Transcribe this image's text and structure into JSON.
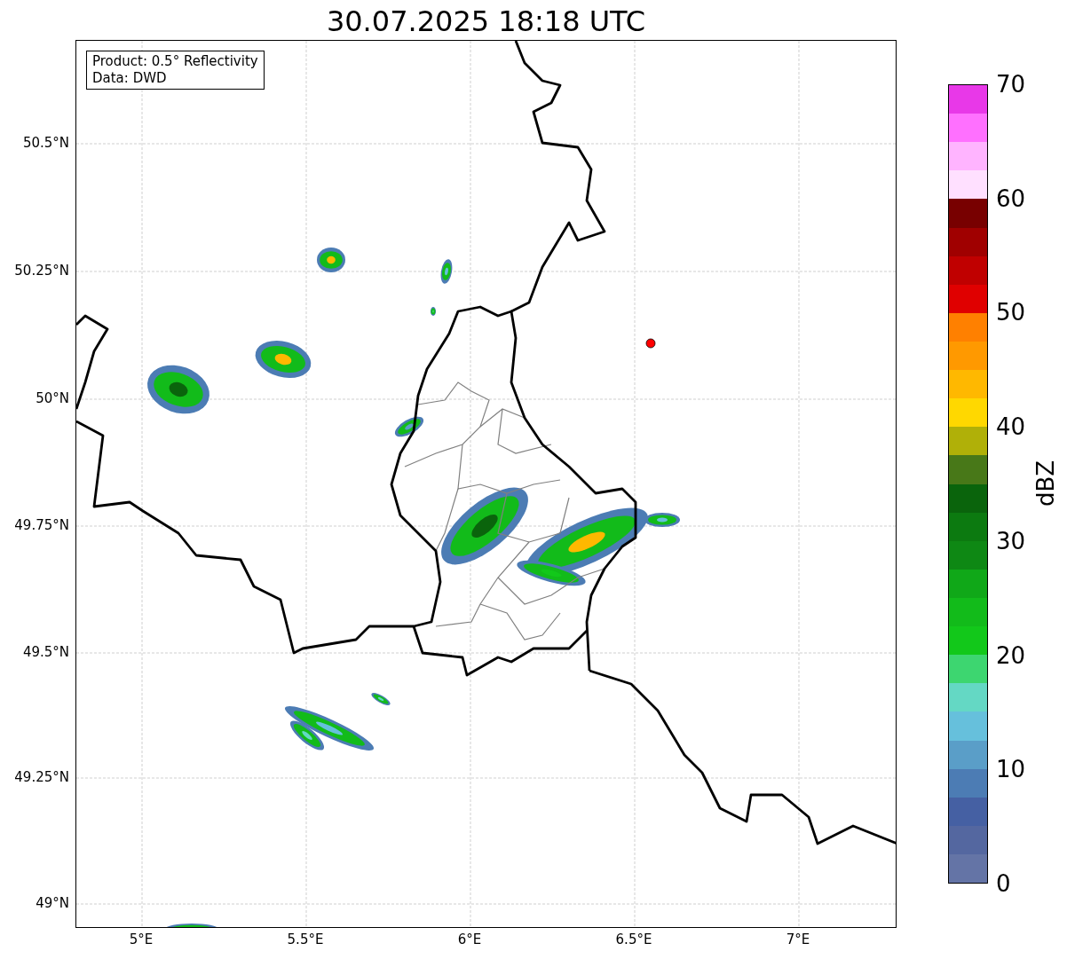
{
  "title": "30.07.2025 18:18 UTC",
  "info_box": [
    "Product: 0.5° Reflectivity",
    "Data: DWD"
  ],
  "map": {
    "x_ticks": [
      "5°E",
      "5.5°E",
      "6°E",
      "6.5°E",
      "7°E"
    ],
    "y_ticks": [
      "50.5°N",
      "50.25°N",
      "50°N",
      "49.75°N",
      "49.5°N",
      "49.25°N",
      "49°N"
    ]
  },
  "colorbar": {
    "label": "dBZ",
    "ticks": [
      "70",
      "60",
      "50",
      "40",
      "30",
      "20",
      "10",
      "0"
    ],
    "segments": [
      {
        "color": "#e838e8"
      },
      {
        "color": "#ff70ff"
      },
      {
        "color": "#ffb4ff"
      },
      {
        "color": "#ffe0ff"
      },
      {
        "color": "#780000"
      },
      {
        "color": "#a00000"
      },
      {
        "color": "#c00000"
      },
      {
        "color": "#e00000"
      },
      {
        "color": "#ff8000"
      },
      {
        "color": "#ff9900"
      },
      {
        "color": "#ffb800"
      },
      {
        "color": "#ffd800"
      },
      {
        "color": "#b0b008"
      },
      {
        "color": "#487818"
      },
      {
        "color": "#0a640c"
      },
      {
        "color": "#0c7a10"
      },
      {
        "color": "#0e8814"
      },
      {
        "color": "#10a818"
      },
      {
        "color": "#12bb1a"
      },
      {
        "color": "#12c81a"
      },
      {
        "color": "#3dd670"
      },
      {
        "color": "#64d8c4"
      },
      {
        "color": "#66c0dc"
      },
      {
        "color": "#5a9ec8"
      },
      {
        "color": "#4c7cb4"
      },
      {
        "color": "#4560a3"
      },
      {
        "color": "#5467a0"
      },
      {
        "color": "#6474a6"
      }
    ]
  }
}
